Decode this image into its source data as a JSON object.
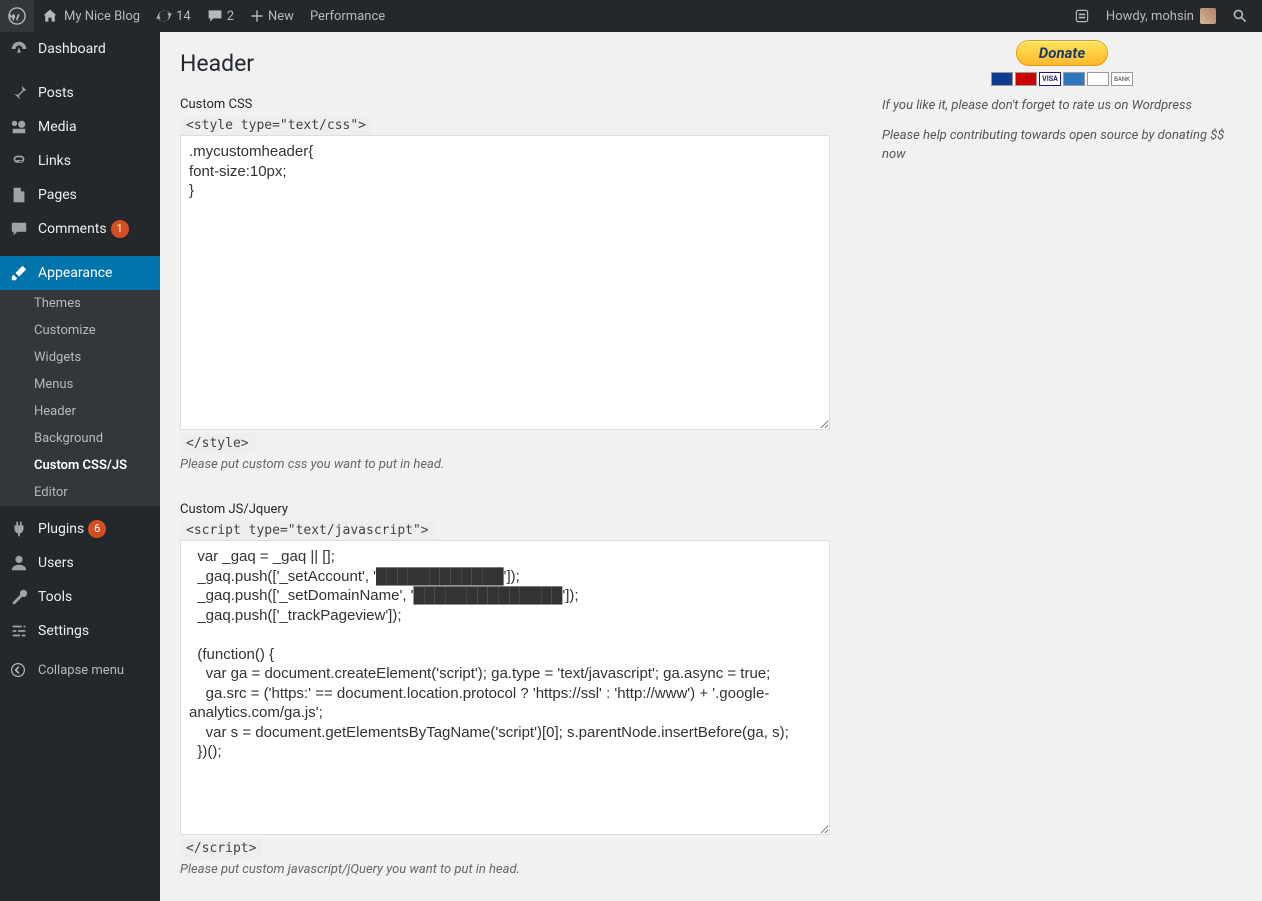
{
  "adminbar": {
    "site_name": "My Nice Blog",
    "updates_count": "14",
    "comments_count": "2",
    "new_label": "New",
    "performance_label": "Performance",
    "howdy": "Howdy, mohsin"
  },
  "menu": {
    "dashboard": "Dashboard",
    "posts": "Posts",
    "media": "Media",
    "links": "Links",
    "pages": "Pages",
    "comments": "Comments",
    "comments_badge": "1",
    "appearance": "Appearance",
    "appearance_sub": {
      "themes": "Themes",
      "customize": "Customize",
      "widgets": "Widgets",
      "menus": "Menus",
      "header": "Header",
      "background": "Background",
      "customcssjs": "Custom CSS/JS",
      "editor": "Editor"
    },
    "plugins": "Plugins",
    "plugins_badge": "6",
    "users": "Users",
    "tools": "Tools",
    "settings": "Settings",
    "collapse": "Collapse menu"
  },
  "page": {
    "title": "Header",
    "css_label": "Custom CSS",
    "css_open_tag": "<style type=\"text/css\">",
    "css_value": ".mycustomheader{\nfont-size:10px;\n}",
    "css_close_tag": "</style>",
    "css_hint": "Please put custom css you want to put in head.",
    "js_label": "Custom JS/Jquery",
    "js_open_tag": "<script type=\"text/javascript\">",
    "js_value": "  var _gaq = _gaq || [];\n  _gaq.push(['_setAccount', '████████████']);\n  _gaq.push(['_setDomainName', '██████████████']);\n  _gaq.push(['_trackPageview']);\n\n  (function() {\n    var ga = document.createElement('script'); ga.type = 'text/javascript'; ga.async = true;\n    ga.src = ('https:' == document.location.protocol ? 'https://ssl' : 'http://www') + '.google-analytics.com/ga.js';\n    var s = document.getElementsByTagName('script')[0]; s.parentNode.insertBefore(ga, s);\n  })();",
    "js_close_tag": "</script>",
    "js_hint": "Please put custom javascript/jQuery you want to put in head."
  },
  "sidebar_panel": {
    "donate_label": "Donate",
    "cards": [
      "Maestro",
      "MC",
      "VISA",
      "AMEX",
      "DISC",
      "BANK"
    ],
    "note1": "If you like it, please don't forget to rate us on Wordpress",
    "note2": "Please help contributing towards open source by donating $$ now"
  }
}
